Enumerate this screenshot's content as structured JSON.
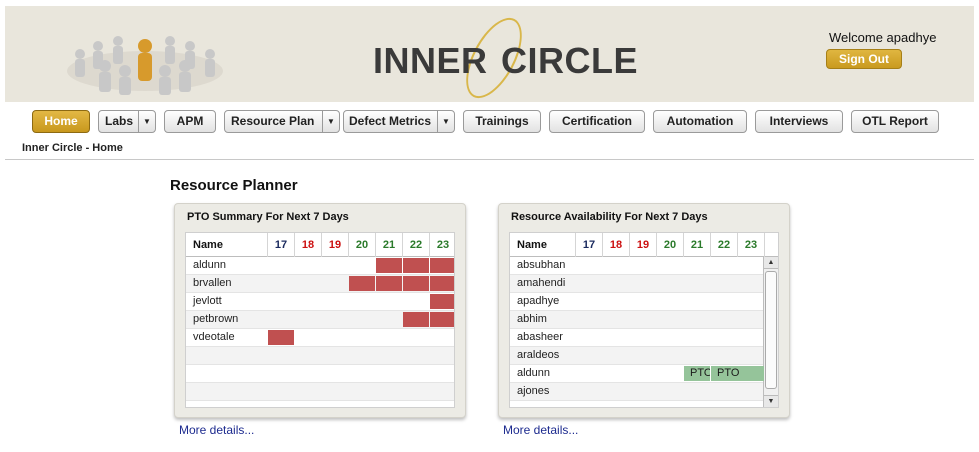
{
  "header": {
    "brand_left": "INNER",
    "brand_right": "CIRCLE",
    "welcome": "Welcome apadhye",
    "signout_label": "Sign Out",
    "colors": {
      "accent": "#d4a72c",
      "header_bg": "#e9e6dc"
    }
  },
  "nav": {
    "items": [
      {
        "label": "Home",
        "active": true,
        "dropdown": false
      },
      {
        "label": "Labs",
        "active": false,
        "dropdown": true
      },
      {
        "label": "APM",
        "active": false,
        "dropdown": false
      },
      {
        "label": "Resource Plan",
        "active": false,
        "dropdown": true
      },
      {
        "label": "Defect Metrics",
        "active": false,
        "dropdown": true
      },
      {
        "label": "Trainings",
        "active": false,
        "dropdown": false
      },
      {
        "label": "Certification",
        "active": false,
        "dropdown": false
      },
      {
        "label": "Automation",
        "active": false,
        "dropdown": false
      },
      {
        "label": "Interviews",
        "active": false,
        "dropdown": false
      },
      {
        "label": "OTL Report",
        "active": false,
        "dropdown": false
      }
    ]
  },
  "breadcrumb": "Inner Circle - Home",
  "page_title": "Resource Planner",
  "days": [
    {
      "label": "17",
      "color": "#1a2a5e"
    },
    {
      "label": "18",
      "color": "#cc1111"
    },
    {
      "label": "19",
      "color": "#cc1111"
    },
    {
      "label": "20",
      "color": "#2a7a2a"
    },
    {
      "label": "21",
      "color": "#2a7a2a"
    },
    {
      "label": "22",
      "color": "#2a7a2a"
    },
    {
      "label": "23",
      "color": "#2a7a2a"
    }
  ],
  "pto": {
    "title": "PTO Summary For Next 7 Days",
    "col_name": "Name",
    "rows": [
      {
        "name": "aldunn",
        "days": [
          4,
          5,
          6
        ]
      },
      {
        "name": "brvallen",
        "days": [
          3,
          4,
          5,
          6
        ]
      },
      {
        "name": "jevlott",
        "days": [
          6
        ]
      },
      {
        "name": "petbrown",
        "days": [
          5,
          6
        ]
      },
      {
        "name": "vdeotale",
        "days": [
          0
        ]
      }
    ],
    "more": "More details..."
  },
  "availability": {
    "title": "Resource Availability For Next 7 Days",
    "col_name": "Name",
    "rows": [
      {
        "name": "absubhan",
        "pto": []
      },
      {
        "name": "amahendi",
        "pto": []
      },
      {
        "name": "apadhye",
        "pto": []
      },
      {
        "name": "abhim",
        "pto": []
      },
      {
        "name": "abasheer",
        "pto": []
      },
      {
        "name": "araldeos",
        "pto": []
      },
      {
        "name": "aldunn",
        "pto": [
          {
            "start": 4,
            "len": 1,
            "label": "PTO"
          },
          {
            "start": 5,
            "len": 2,
            "label": "PTO"
          }
        ]
      },
      {
        "name": "ajones",
        "pto": []
      }
    ],
    "more": "More details..."
  }
}
